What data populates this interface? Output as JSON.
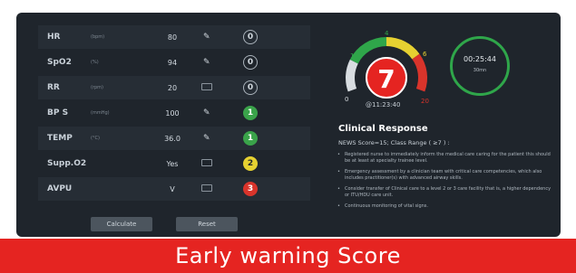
{
  "table": {
    "rows": [
      {
        "name": "HR",
        "unit": "(bpm)",
        "value": "80",
        "input": "edit",
        "score": "0"
      },
      {
        "name": "SpO2",
        "unit": "(%)",
        "value": "94",
        "input": "edit",
        "score": "0"
      },
      {
        "name": "RR",
        "unit": "(rpm)",
        "value": "20",
        "input": "keyboard",
        "score": "0"
      },
      {
        "name": "BP S",
        "unit": "(mmHg)",
        "value": "100",
        "input": "edit",
        "score": "1"
      },
      {
        "name": "TEMP",
        "unit": "(°C)",
        "value": "36.0",
        "input": "edit",
        "score": "1"
      },
      {
        "name": "Supp.O2",
        "unit": "",
        "value": "Yes",
        "input": "keyboard",
        "score": "2"
      },
      {
        "name": "AVPU",
        "unit": "",
        "value": "V",
        "input": "keyboard",
        "score": "3"
      }
    ]
  },
  "buttons": {
    "calculate": "Calculate",
    "reset": "Reset"
  },
  "gauge": {
    "score": "7",
    "tick_0": "0",
    "tick_1": "1",
    "tick_4": "4",
    "tick_6": "6",
    "tick_20": "20",
    "timestamp": "@11:23:40",
    "colors": {
      "green": "#2fa64a",
      "yellow": "#e6d131",
      "red": "#d9342b",
      "grey": "#d8dde1"
    }
  },
  "timer": {
    "time": "00:25:44",
    "label": "30mn"
  },
  "clinical": {
    "title": "Clinical Response",
    "subtitle": "NEWS Score=15; Class Range ( ≥7 ) :",
    "bullets": [
      "Registered nurse to immediately inform the medical care caring for the patient this should be at least at specialty trainee level.",
      "Emergency assessment by a clinician team with critical care competencies, which also includes practitioner(s) with advanced airway skills.",
      "Consider transfer of Clinical care to a level 2 or 3 care facility that is, a higher dependency or ITU/HDU care unit.",
      "Continuous monitoring of vital signs."
    ]
  },
  "banner": {
    "title": "Early warning Score"
  }
}
